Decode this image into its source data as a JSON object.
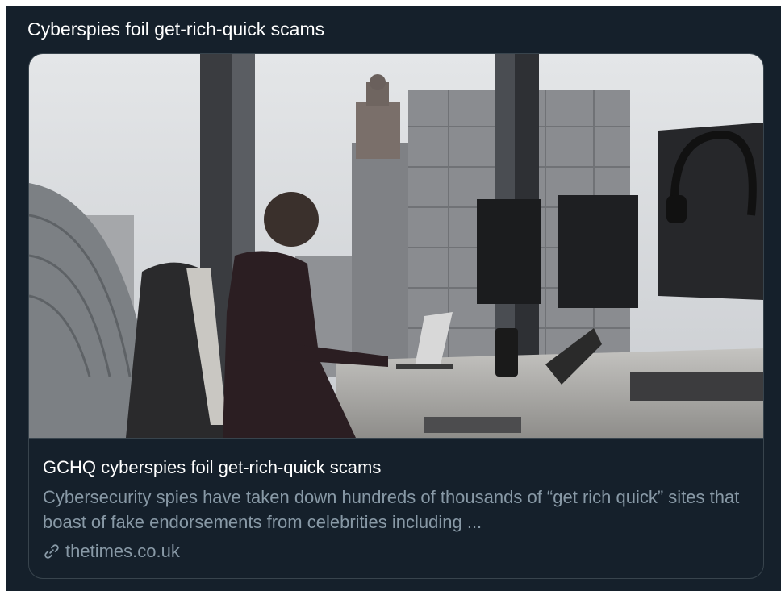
{
  "tweet": {
    "text": "Cyberspies foil get-rich-quick scams"
  },
  "card": {
    "image_icon": "photo-office-silhouette",
    "title": "GCHQ cyberspies foil get-rich-quick scams",
    "description": "Cybersecurity spies have taken down hundreds of thousands of “get rich quick” sites that boast of fake endorsements from celebrities including ...",
    "domain_icon": "link-icon",
    "domain": "thetimes.co.uk"
  },
  "colors": {
    "background": "#15202b",
    "border": "#38444d",
    "primary_text": "#ffffff",
    "secondary_text": "#8899a6"
  }
}
